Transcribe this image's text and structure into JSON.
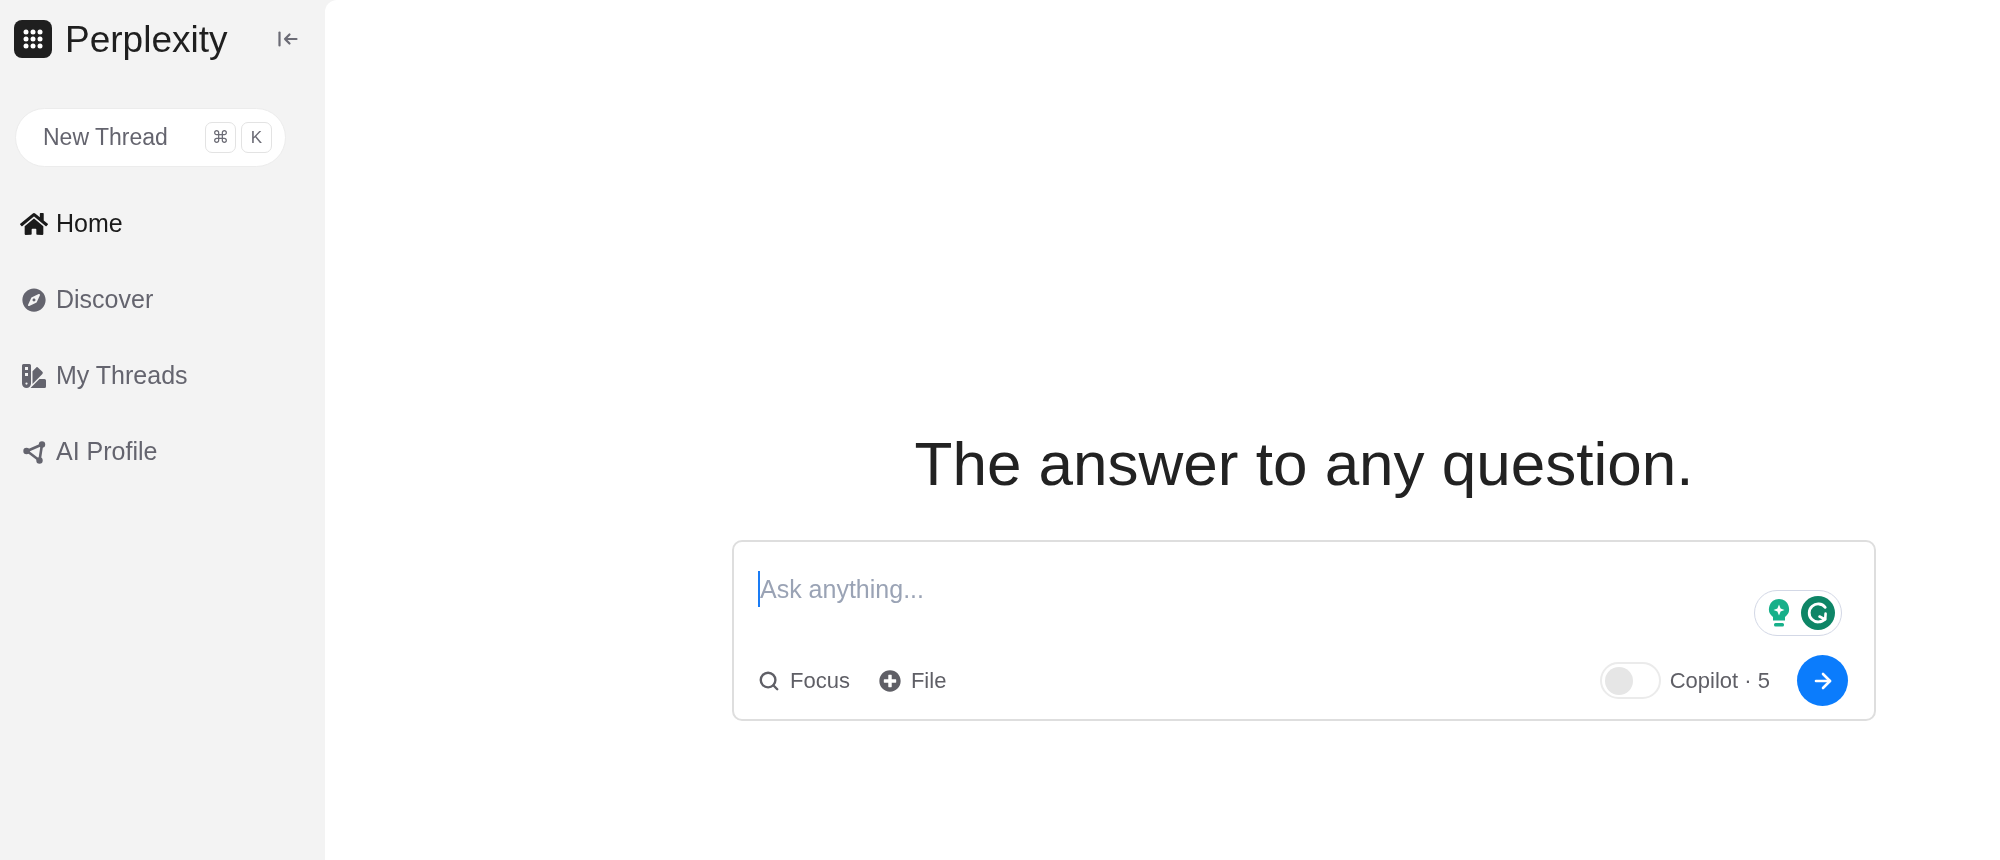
{
  "sidebar": {
    "logo": "Perplexity",
    "new_thread": {
      "label": "New Thread",
      "keys": [
        "⌘",
        "K"
      ]
    },
    "nav": [
      {
        "label": "Home",
        "selected": true
      },
      {
        "label": "Discover",
        "selected": false
      },
      {
        "label": "My Threads",
        "selected": false
      },
      {
        "label": "AI Profile",
        "selected": false
      }
    ]
  },
  "main": {
    "heading": "The answer to any question.",
    "search": {
      "placeholder": "Ask anything...",
      "focused": true,
      "tools": [
        "Focus",
        "File"
      ],
      "copilot": {
        "label": "Copilot · 5",
        "on": false
      }
    }
  }
}
